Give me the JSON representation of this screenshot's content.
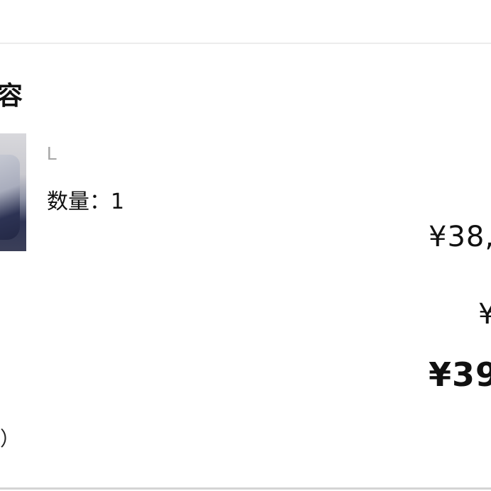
{
  "order_section": {
    "title": "容"
  },
  "item": {
    "thumbnail": "product-thumbnail",
    "variant": "L",
    "quantity_label": "数量：1"
  },
  "pricing": {
    "item_price": "¥38,",
    "secondary_price": "¥",
    "total_price": "¥39"
  },
  "footer": {
    "tax_note": "税）"
  }
}
